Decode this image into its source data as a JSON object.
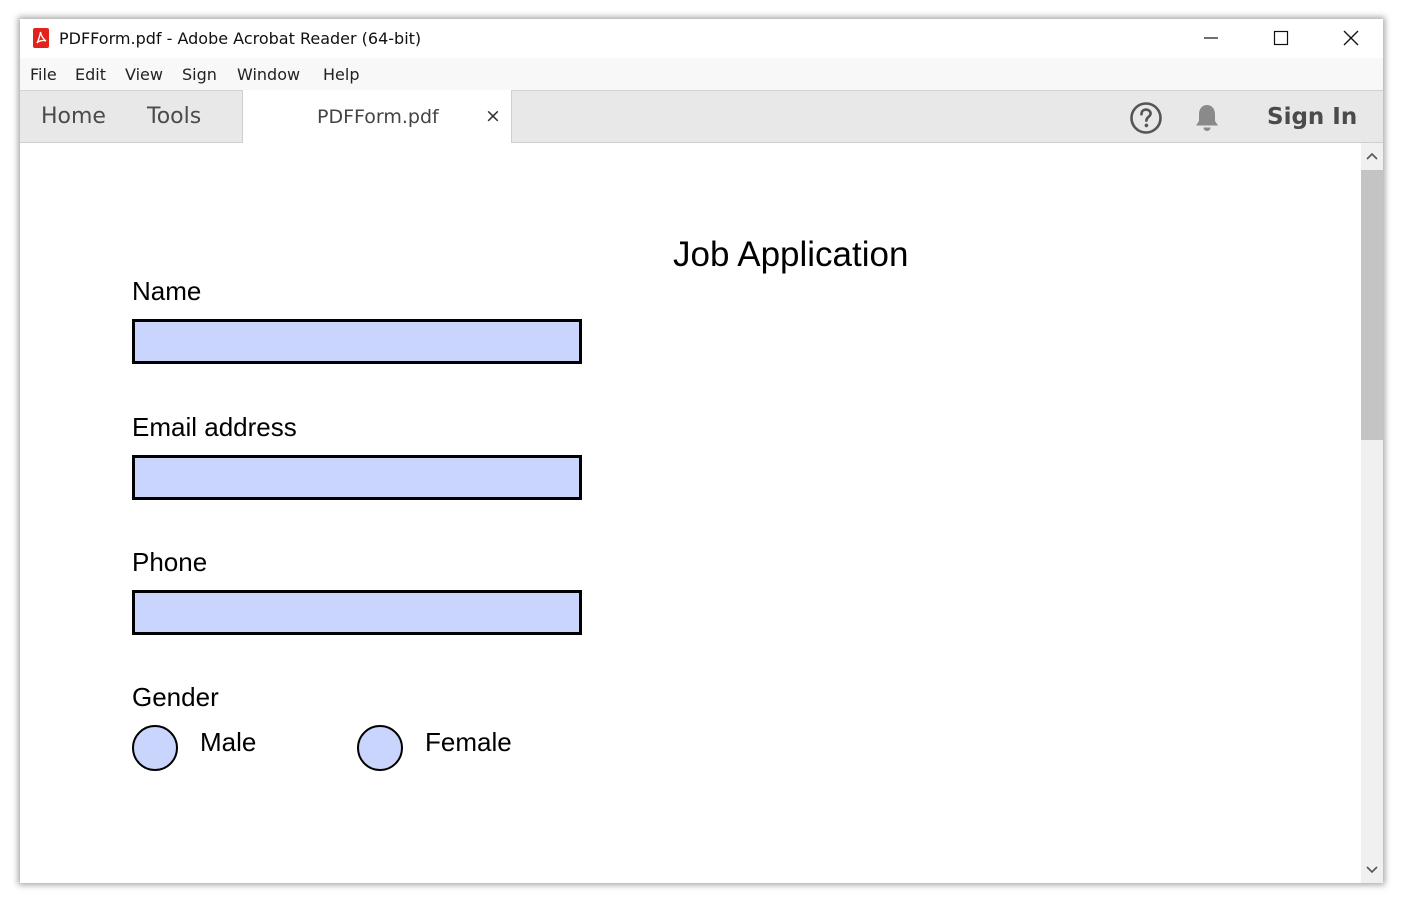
{
  "window": {
    "title": "PDFForm.pdf - Adobe Acrobat Reader (64-bit)",
    "app_icon": "acrobat-pdf-icon",
    "controls": [
      "minimize-icon",
      "maximize-icon",
      "close-icon"
    ]
  },
  "menu": {
    "items": [
      "File",
      "Edit",
      "View",
      "Sign",
      "Window",
      "Help"
    ]
  },
  "toolbar": {
    "home": "Home",
    "tools": "Tools",
    "document_tab": {
      "label": "PDFForm.pdf",
      "close": "×"
    },
    "help_icon": "help-icon",
    "notification_icon": "bell-icon",
    "sign_in": "Sign In"
  },
  "form": {
    "title": "Job Application",
    "fields": [
      {
        "label": "Name",
        "value": ""
      },
      {
        "label": "Email address",
        "value": ""
      },
      {
        "label": "Phone",
        "value": ""
      }
    ],
    "gender": {
      "label": "Gender",
      "options": [
        "Male",
        "Female"
      ],
      "selected": null
    }
  },
  "colors": {
    "field_fill": "#cad5fd",
    "field_border": "#000000",
    "acrobat_red": "#e3231b"
  }
}
